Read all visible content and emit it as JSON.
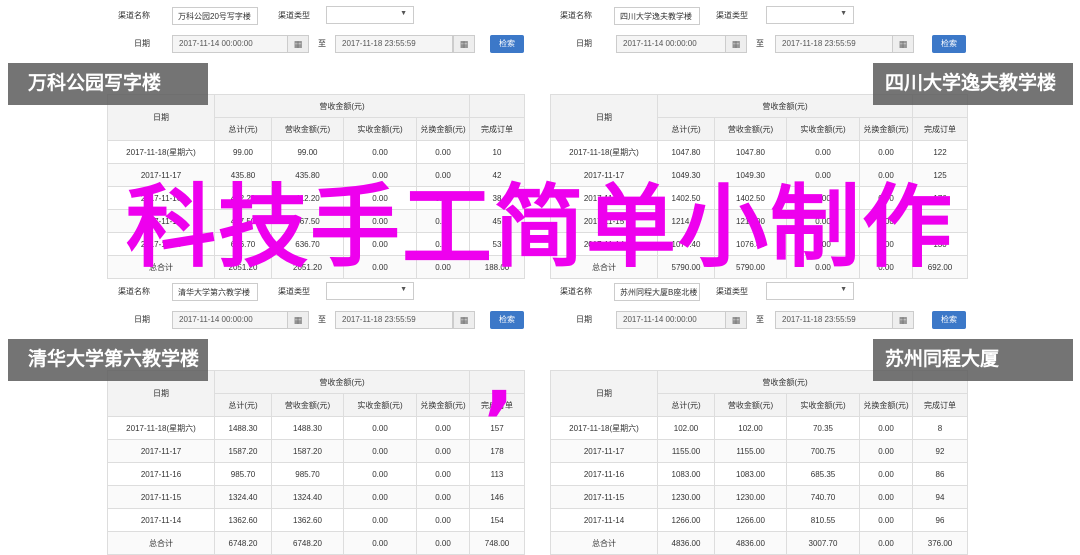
{
  "overlay": {
    "title": "科技手工简单小制作",
    "comma": ","
  },
  "form": {
    "channel_label": "渠道名称",
    "type_label": "渠道类型",
    "date_label": "日期",
    "to_label": "至",
    "search_label": "检索",
    "start_date": "2017-11-14 00:00:00",
    "end_date": "2017-11-18 23:55:59",
    "calendar_icon": "calendar-grid-icon",
    "select_icon": "chevron-down-icon"
  },
  "table_headers": {
    "date": "日期",
    "group": "营收金额(元)",
    "cols": [
      "总计(元)",
      "营收金额(元)",
      "实收金额(元)",
      "兑换金额(元)",
      "完成订单"
    ]
  },
  "panels": [
    {
      "channel": "万科公园20号写字楼",
      "banner": "万科公园写字楼",
      "rows": [
        [
          "2017-11-18(星期六)",
          "99.00",
          "99.00",
          "0.00",
          "0.00",
          "10"
        ],
        [
          "2017-11-17",
          "435.80",
          "435.80",
          "0.00",
          "0.00",
          "42"
        ],
        [
          "2017-11-16",
          "412.20",
          "412.20",
          "0.00",
          "0.00",
          "38"
        ],
        [
          "2017-11-15",
          "467.50",
          "467.50",
          "0.00",
          "0.00",
          "45"
        ],
        [
          "2017-11-14",
          "636.70",
          "636.70",
          "0.00",
          "0.00",
          "53"
        ],
        [
          "总合计",
          "2051.20",
          "2051.20",
          "0.00",
          "0.00",
          "188.00"
        ]
      ]
    },
    {
      "channel": "四川大学逸夫教学楼",
      "banner": "四川大学逸夫教学楼",
      "rows": [
        [
          "2017-11-18(星期六)",
          "1047.80",
          "1047.80",
          "0.00",
          "0.00",
          "122"
        ],
        [
          "2017-11-17",
          "1049.30",
          "1049.30",
          "0.00",
          "0.00",
          "125"
        ],
        [
          "2017-11-16",
          "1402.50",
          "1402.50",
          "0.00",
          "0.00",
          "176"
        ],
        [
          "2017-11-15",
          "1214.00",
          "1214.00",
          "0.00",
          "0.00",
          "139"
        ],
        [
          "2017-11-14",
          "1076.40",
          "1076.40",
          "0.00",
          "0.00",
          "130"
        ],
        [
          "总合计",
          "5790.00",
          "5790.00",
          "0.00",
          "0.00",
          "692.00"
        ]
      ]
    },
    {
      "channel": "清华大学第六教学楼",
      "banner": "清华大学第六教学楼",
      "rows": [
        [
          "2017-11-18(星期六)",
          "1488.30",
          "1488.30",
          "0.00",
          "0.00",
          "157"
        ],
        [
          "2017-11-17",
          "1587.20",
          "1587.20",
          "0.00",
          "0.00",
          "178"
        ],
        [
          "2017-11-16",
          "985.70",
          "985.70",
          "0.00",
          "0.00",
          "113"
        ],
        [
          "2017-11-15",
          "1324.40",
          "1324.40",
          "0.00",
          "0.00",
          "146"
        ],
        [
          "2017-11-14",
          "1362.60",
          "1362.60",
          "0.00",
          "0.00",
          "154"
        ],
        [
          "总合计",
          "6748.20",
          "6748.20",
          "0.00",
          "0.00",
          "748.00"
        ]
      ]
    },
    {
      "channel": "苏州同程大厦B座北楼",
      "banner": "苏州同程大厦",
      "rows": [
        [
          "2017-11-18(星期六)",
          "102.00",
          "102.00",
          "70.35",
          "0.00",
          "8"
        ],
        [
          "2017-11-17",
          "1155.00",
          "1155.00",
          "700.75",
          "0.00",
          "92"
        ],
        [
          "2017-11-16",
          "1083.00",
          "1083.00",
          "685.35",
          "0.00",
          "86"
        ],
        [
          "2017-11-15",
          "1230.00",
          "1230.00",
          "740.70",
          "0.00",
          "94"
        ],
        [
          "2017-11-14",
          "1266.00",
          "1266.00",
          "810.55",
          "0.00",
          "96"
        ],
        [
          "总合计",
          "4836.00",
          "4836.00",
          "3007.70",
          "0.00",
          "376.00"
        ]
      ]
    }
  ]
}
